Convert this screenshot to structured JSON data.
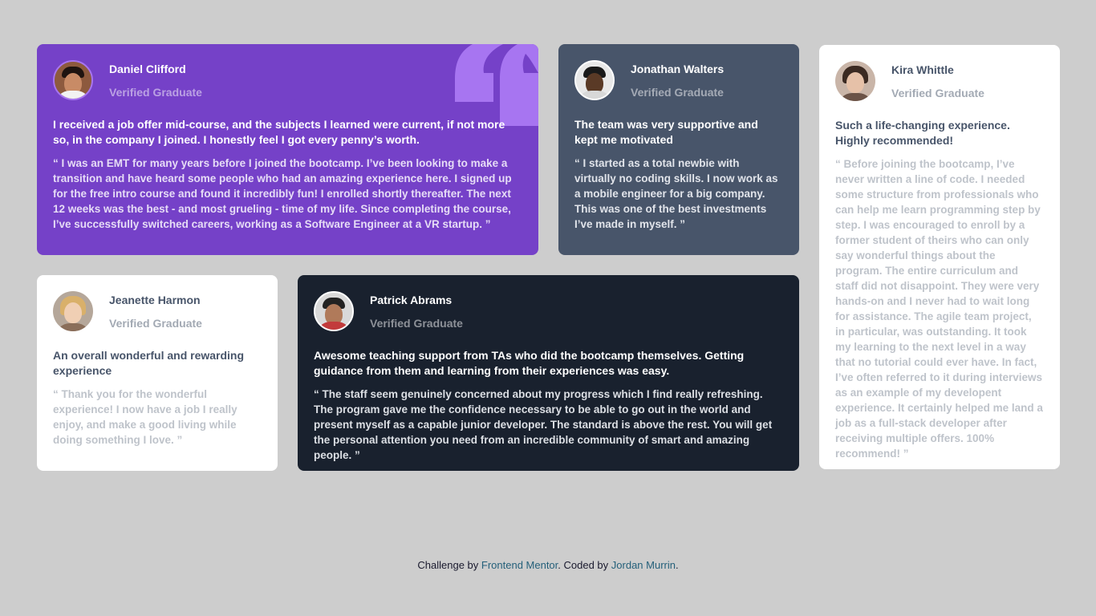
{
  "colors": {
    "page_bg": "#cdcdcd",
    "purple": "#7541c8",
    "slate": "#48556a",
    "dark": "#19212e",
    "white": "#ffffff",
    "quote_accent": "#a775f1",
    "link": "#25607a"
  },
  "testimonials": [
    {
      "name": "Daniel Clifford",
      "role": "Verified Graduate",
      "headline": "I received a job offer mid-course, and the subjects I learned were current, if not more so, in the company I joined. I honestly feel I got every penny’s worth.",
      "quote": "“ I was an EMT for many years before I joined the bootcamp. I’ve been looking to make a transition and have heard some people who had an amazing experience here. I signed up for the free intro course and found it incredibly fun! I enrolled shortly thereafter. The next 12 weeks was the best - and most grueling - time of my life. Since completing the course, I’ve successfully switched careers, working as a Software Engineer at a VR startup. ”",
      "avatar_icon": "avatar-daniel"
    },
    {
      "name": "Jonathan Walters",
      "role": "Verified Graduate",
      "headline": "The team was very supportive and kept me motivated",
      "quote": "“ I started as a total newbie with virtually no coding skills. I now work as a mobile engineer for a big company. This was one of the best investments I’ve made in myself. ”",
      "avatar_icon": "avatar-jonathan"
    },
    {
      "name": "Kira Whittle",
      "role": "Verified Graduate",
      "headline": "Such a life-changing experience. Highly recommended!",
      "quote": "“ Before joining the bootcamp, I’ve never written a line of code. I needed some structure from professionals who can help me learn programming step by step. I was encouraged to enroll by a former student of theirs who can only say wonderful things about the program. The entire curriculum and staff did not disappoint. They were very hands-on and I never had to wait long for assistance. The agile team project, in particular, was outstanding. It took my learning to the next level in a way that no tutorial could ever have. In fact, I’ve often referred to it during interviews as an example of my developent experience. It certainly helped me land a job as a full-stack developer after receiving multiple offers. 100% recommend! ”",
      "avatar_icon": "avatar-kira"
    },
    {
      "name": "Jeanette Harmon",
      "role": "Verified Graduate",
      "headline": "An overall wonderful and rewarding experience",
      "quote": "“ Thank you for the wonderful experience! I now have a job I really enjoy, and make a good living while doing something I love. ”",
      "avatar_icon": "avatar-jeanette"
    },
    {
      "name": "Patrick Abrams",
      "role": "Verified Graduate",
      "headline": "Awesome teaching support from TAs who did the bootcamp themselves. Getting guidance from them and learning from their experiences was easy.",
      "quote": "“ The staff seem genuinely concerned about my progress which I find really refreshing. The program gave me the confidence necessary to be able to go out in the world and present myself as a capable junior developer. The standard is above the rest. You will get the personal attention you need from an incredible community of smart and amazing people. ”",
      "avatar_icon": "avatar-patrick"
    }
  ],
  "footer": {
    "prefix": "Challenge by",
    "challenge_link": "Frontend Mentor",
    "middle": ". Coded by",
    "author_link": "Jordan Murrin",
    "suffix": "."
  }
}
